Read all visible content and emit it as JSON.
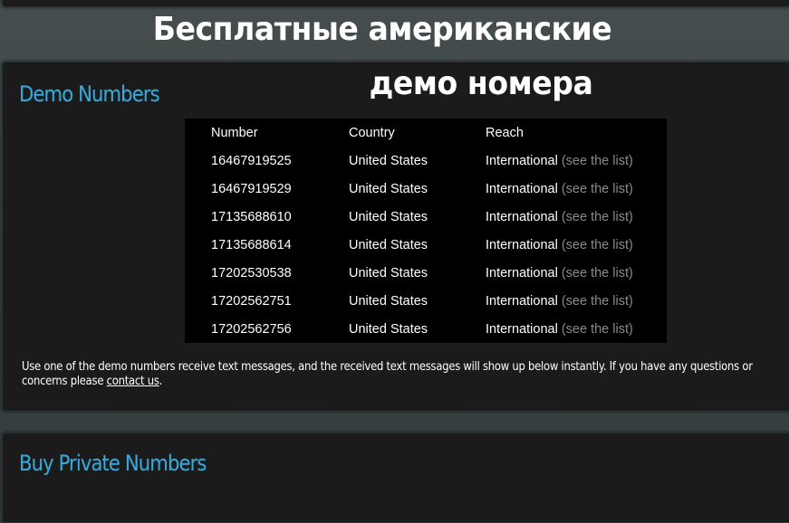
{
  "overlay": {
    "line1": "Бесплатные американские",
    "line2": "демо номера"
  },
  "demo_section": {
    "title": "Demo Numbers",
    "columns": [
      "Number",
      "Country",
      "Reach"
    ],
    "rows": [
      {
        "number": "16467919525",
        "country": "United States",
        "reach": "International",
        "link": "(see the list)"
      },
      {
        "number": "16467919529",
        "country": "United States",
        "reach": "International",
        "link": "(see the list)"
      },
      {
        "number": "17135688610",
        "country": "United States",
        "reach": "International",
        "link": "(see the list)"
      },
      {
        "number": "17135688614",
        "country": "United States",
        "reach": "International",
        "link": "(see the list)"
      },
      {
        "number": "17202530538",
        "country": "United States",
        "reach": "International",
        "link": "(see the list)"
      },
      {
        "number": "17202562751",
        "country": "United States",
        "reach": "International",
        "link": "(see the list)"
      },
      {
        "number": "17202562756",
        "country": "United States",
        "reach": "International",
        "link": "(see the list)"
      }
    ],
    "note_line1": "Use one of the demo numbers receive text messages, and the received text messages will show up below instantly. If you have any questions or",
    "note_line2_prefix": "concerns please ",
    "contact_link": "contact us",
    "note_line2_suffix": "."
  },
  "buy_section": {
    "title": "Buy Private Numbers"
  },
  "colors": {
    "accent": "#3fa7d6",
    "background": "#1b1b1b",
    "link_muted": "#8a8a8a"
  }
}
